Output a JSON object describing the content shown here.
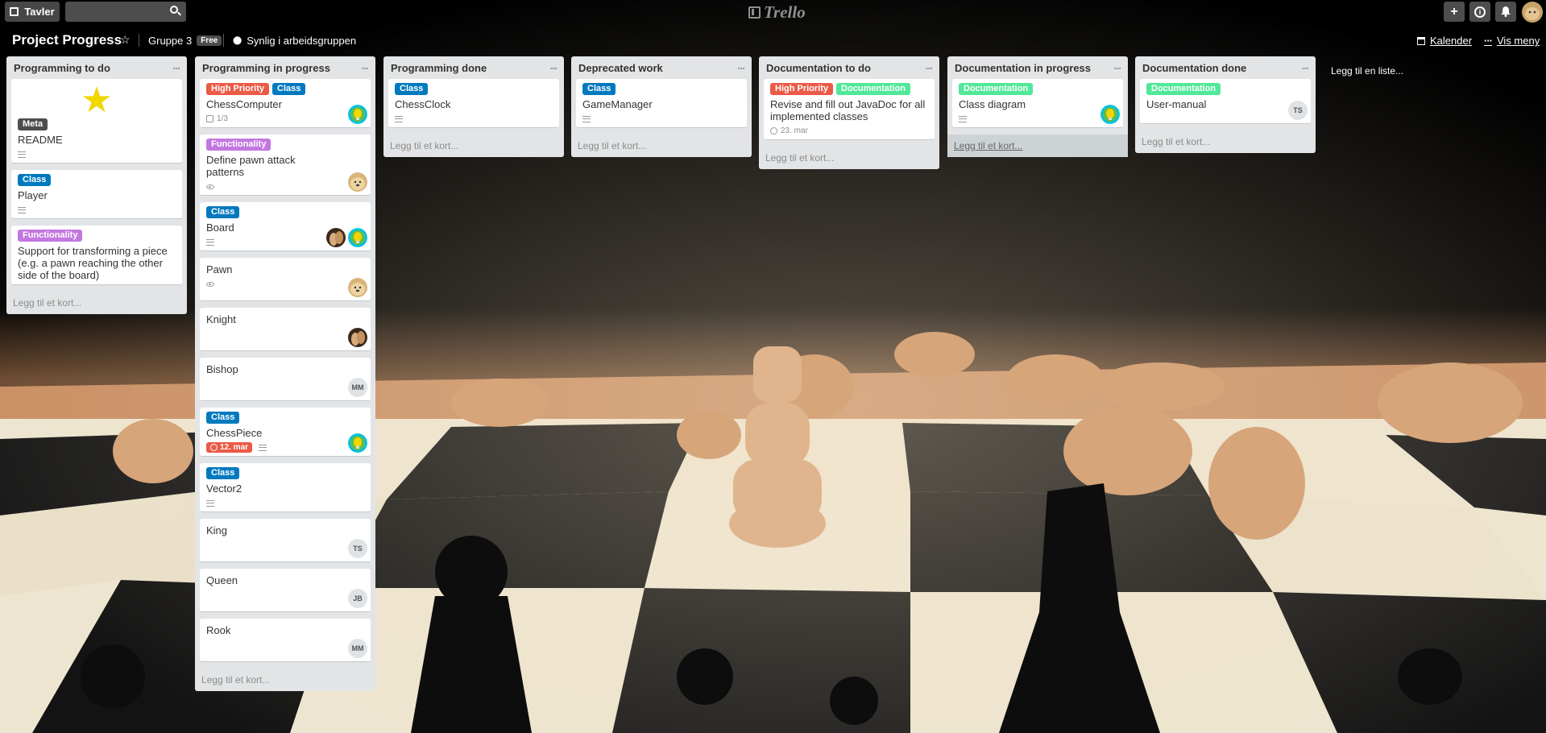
{
  "topbar": {
    "boards_label": "Tavler",
    "search_value": "",
    "logo_text": "Trello",
    "add_icon": "plus-icon",
    "info_icon": "info-icon",
    "bell_icon": "bell-icon"
  },
  "board": {
    "title": "Project Progress",
    "team": "Gruppe 3",
    "team_badge": "Free",
    "visibility": "Synlig i arbeidsgruppen",
    "calendar": "Kalender",
    "show_menu": "Vis meny",
    "add_list": "Legg til en liste...",
    "add_card": "Legg til et kort..."
  },
  "colors": {
    "high_priority": "#eb5a46",
    "class": "#0079bf",
    "functionality": "#c377e0",
    "meta": "#4d4d4d",
    "documentation": "#51e898"
  },
  "lists": [
    {
      "title": "Programming to do",
      "cards": [
        {
          "star": true,
          "labels": [
            "Meta"
          ],
          "title": "README",
          "badges": {
            "desc": true
          }
        },
        {
          "labels": [
            "Class"
          ],
          "title": "Player",
          "badges": {
            "desc": true
          }
        },
        {
          "labels": [
            "Functionality"
          ],
          "title": "Support for transforming a piece (e.g. a pawn reaching the other side of the board)"
        }
      ]
    },
    {
      "title": "Programming in progress",
      "cards": [
        {
          "labels": [
            "High Priority",
            "Class"
          ],
          "title": "ChessComputer",
          "badges": {
            "checklist": "1/3"
          },
          "members": [
            "bulb"
          ]
        },
        {
          "labels": [
            "Functionality"
          ],
          "title": "Define pawn attack patterns",
          "badges": {
            "watch": true
          },
          "members": [
            "doge"
          ]
        },
        {
          "labels": [
            "Class"
          ],
          "title": "Board",
          "badges": {
            "desc": true
          },
          "members": [
            "chess",
            "bulb"
          ]
        },
        {
          "title": "Pawn",
          "badges": {
            "watch": true
          },
          "members": [
            "doge"
          ]
        },
        {
          "title": "Knight",
          "members": [
            "chess"
          ]
        },
        {
          "title": "Bishop",
          "members": [
            "MM"
          ]
        },
        {
          "labels": [
            "Class"
          ],
          "title": "ChessPiece",
          "badges": {
            "due": "12. mar",
            "desc": true
          },
          "members": [
            "bulb"
          ]
        },
        {
          "labels": [
            "Class"
          ],
          "title": "Vector2",
          "badges": {
            "desc": true
          }
        },
        {
          "title": "King",
          "members": [
            "TS"
          ]
        },
        {
          "title": "Queen",
          "members": [
            "JB"
          ]
        },
        {
          "title": "Rook",
          "members": [
            "MM"
          ]
        }
      ]
    },
    {
      "title": "Programming done",
      "cards": [
        {
          "labels": [
            "Class"
          ],
          "title": "ChessClock",
          "badges": {
            "desc": true
          }
        }
      ]
    },
    {
      "title": "Deprecated work",
      "cards": [
        {
          "labels": [
            "Class"
          ],
          "title": "GameManager",
          "badges": {
            "desc": true
          }
        }
      ]
    },
    {
      "title": "Documentation to do",
      "cards": [
        {
          "labels": [
            "High Priority",
            "Documentation"
          ],
          "title": "Revise and fill out JavaDoc for all implemented classes",
          "badges": {
            "date": "23. mar"
          }
        }
      ]
    },
    {
      "title": "Documentation in progress",
      "cards": [
        {
          "labels": [
            "Documentation"
          ],
          "title": "Class diagram",
          "badges": {
            "desc": true
          },
          "members": [
            "bulb"
          ]
        }
      ],
      "add_highlight": true
    },
    {
      "title": "Documentation done",
      "cards": [
        {
          "labels": [
            "Documentation"
          ],
          "title": "User-manual",
          "members": [
            "TS"
          ]
        }
      ]
    }
  ]
}
